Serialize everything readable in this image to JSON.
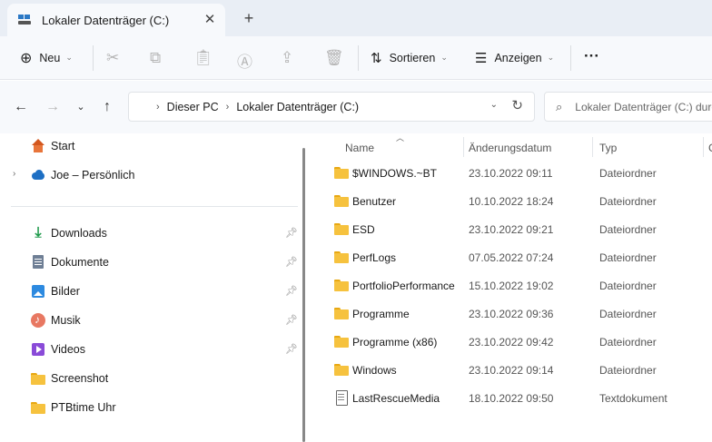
{
  "tab": {
    "title": "Lokaler Datenträger (C:)",
    "close_glyph": "✕",
    "new_tab_glyph": "+"
  },
  "toolbar": {
    "new_label": "Neu",
    "sort_label": "Sortieren",
    "view_label": "Anzeigen",
    "more_glyph": "···"
  },
  "address": {
    "crumbs": [
      "Dieser PC",
      "Lokaler Datenträger (C:)"
    ],
    "search_placeholder": "Lokaler Datenträger (C:) durchsuchen"
  },
  "navpane": {
    "top": [
      {
        "label": "Start",
        "icon": "home-icon"
      },
      {
        "label": "Joe – Persönlich",
        "icon": "cloud-icon",
        "expandable": true
      }
    ],
    "quick_access": [
      {
        "label": "Downloads",
        "icon": "download-icon",
        "pinned": true
      },
      {
        "label": "Dokumente",
        "icon": "doc-icon",
        "pinned": true
      },
      {
        "label": "Bilder",
        "icon": "pic-icon",
        "pinned": true
      },
      {
        "label": "Musik",
        "icon": "music-icon",
        "pinned": true
      },
      {
        "label": "Videos",
        "icon": "video-icon",
        "pinned": true
      },
      {
        "label": "Screenshot",
        "icon": "folder-icon",
        "pinned": false
      },
      {
        "label": "PTBtime Uhr",
        "icon": "folder-icon",
        "pinned": false
      }
    ]
  },
  "columns": {
    "name": "Name",
    "date": "Änderungsdatum",
    "type": "Typ",
    "size": "G"
  },
  "files": [
    {
      "name": "$WINDOWS.~BT",
      "date": "23.10.2022 09:11",
      "type": "Dateiordner",
      "icon": "folder-icon"
    },
    {
      "name": "Benutzer",
      "date": "10.10.2022 18:24",
      "type": "Dateiordner",
      "icon": "folder-icon"
    },
    {
      "name": "ESD",
      "date": "23.10.2022 09:21",
      "type": "Dateiordner",
      "icon": "folder-icon"
    },
    {
      "name": "PerfLogs",
      "date": "07.05.2022 07:24",
      "type": "Dateiordner",
      "icon": "folder-icon"
    },
    {
      "name": "PortfolioPerformance",
      "date": "15.10.2022 19:02",
      "type": "Dateiordner",
      "icon": "folder-icon"
    },
    {
      "name": "Programme",
      "date": "23.10.2022 09:36",
      "type": "Dateiordner",
      "icon": "folder-icon"
    },
    {
      "name": "Programme (x86)",
      "date": "23.10.2022 09:42",
      "type": "Dateiordner",
      "icon": "folder-icon"
    },
    {
      "name": "Windows",
      "date": "23.10.2022 09:14",
      "type": "Dateiordner",
      "icon": "folder-icon"
    },
    {
      "name": "LastRescueMedia",
      "date": "18.10.2022 09:50",
      "type": "Textdokument",
      "icon": "txt-icon"
    }
  ]
}
